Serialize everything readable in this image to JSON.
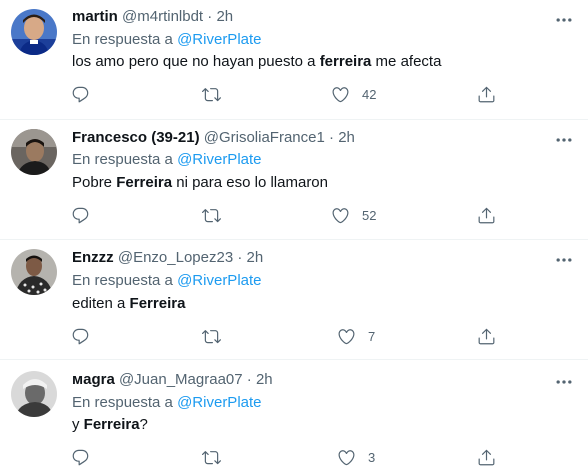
{
  "reply_prefix": "En respuesta a",
  "tweets": [
    {
      "name": "martin",
      "handle": "@m4rtinlbdt",
      "time": "2h",
      "reply_to": "@RiverPlate",
      "text_before": "los amo pero que no hayan puesto a ",
      "text_bold": "ferreira",
      "text_after": " me afecta",
      "likes": "42"
    },
    {
      "name": "Francesco (39-21)",
      "handle": "@GrisoliaFrance1",
      "time": "2h",
      "reply_to": "@RiverPlate",
      "text_before": "Pobre ",
      "text_bold": "Ferreira",
      "text_after": " ni para eso lo llamaron",
      "likes": "52"
    },
    {
      "name": "Enzzz",
      "handle": "@Enzo_Lopez23",
      "time": "2h",
      "reply_to": "@RiverPlate",
      "text_before": "editen a ",
      "text_bold": "Ferreira",
      "text_after": "",
      "likes": "7"
    },
    {
      "name": "мagra",
      "handle": "@Juan_Magraa07",
      "time": "2h",
      "reply_to": "@RiverPlate",
      "text_before": "y ",
      "text_bold": "Ferreira",
      "text_after": "?",
      "likes": "3"
    }
  ],
  "separator": "·",
  "icons": [
    "reply-icon",
    "retweet-icon",
    "like-icon",
    "share-icon",
    "more-icon"
  ],
  "colors": {
    "link": "#1d9bf0",
    "secondary": "#536471",
    "text": "#0f1419"
  }
}
